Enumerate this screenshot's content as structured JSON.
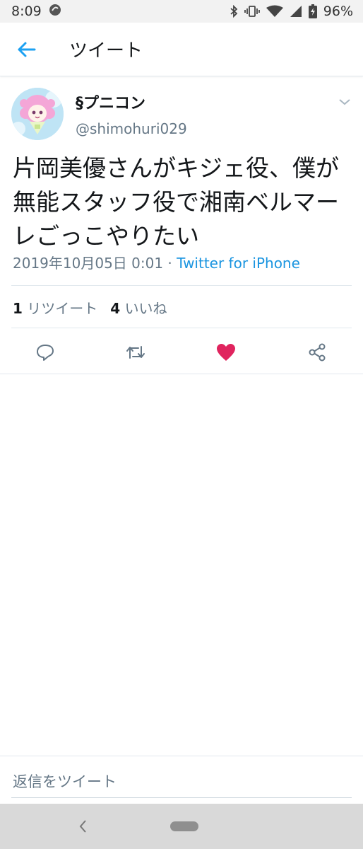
{
  "status_bar": {
    "time": "8:09",
    "battery": "96%",
    "icons": [
      "data-saver-icon",
      "bluetooth-icon",
      "vibrate-icon",
      "wifi-icon",
      "signal-icon",
      "battery-icon"
    ]
  },
  "header": {
    "title": "ツイート",
    "back_icon": "arrow-left-icon"
  },
  "tweet": {
    "display_name": "§プニコン",
    "handle": "@shimohuri029",
    "text": "片岡美優さんがキジェ役、僕が無能スタッフ役で湘南ベルマーレごっこやりたい",
    "timestamp": "2019年10月05日 0:01",
    "separator": " · ",
    "source": "Twitter for iPhone",
    "retweet_count": "1",
    "retweet_label": "リツイート",
    "like_count": "4",
    "like_label": "いいね",
    "liked": true
  },
  "actions": [
    "reply-icon",
    "retweet-icon",
    "heart-icon",
    "share-icon"
  ],
  "colors": {
    "accent": "#1b95e0",
    "like": "#e0245e",
    "secondary_text": "#657786"
  },
  "reply": {
    "placeholder": "返信をツイート"
  }
}
